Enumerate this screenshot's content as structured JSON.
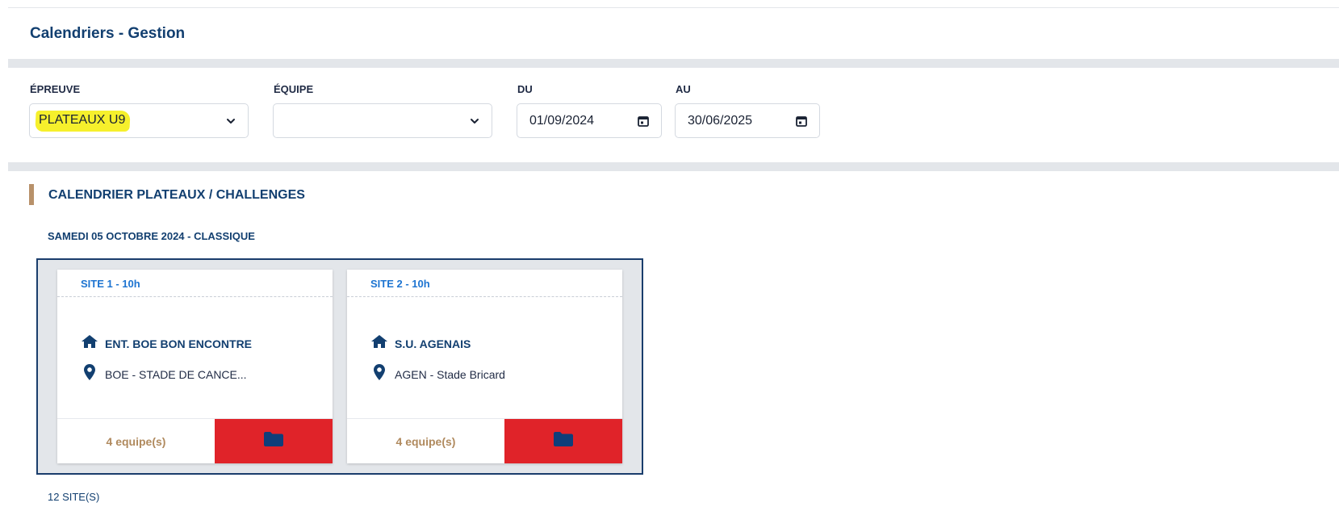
{
  "page": {
    "title": "Calendriers - Gestion"
  },
  "filters": {
    "epreuve": {
      "label": "ÉPREUVE",
      "value": "PLATEAUX U9"
    },
    "equipe": {
      "label": "ÉQUIPE",
      "value": ""
    },
    "du": {
      "label": "DU",
      "value": "01/09/2024"
    },
    "au": {
      "label": "AU",
      "value": "30/06/2025"
    }
  },
  "section": {
    "title": "CALENDRIER PLATEAUX / CHALLENGES",
    "event_date": "SAMEDI 05 OCTOBRE 2024 - CLASSIQUE",
    "sites": [
      {
        "header": "SITE 1 - 10h",
        "club": "ENT. BOE BON ENCONTRE",
        "location": "BOE - STADE DE CANCE...",
        "teams": "4 equipe(s)"
      },
      {
        "header": "SITE 2 - 10h",
        "club": "S.U. AGENAIS",
        "location": "AGEN - Stade Bricard",
        "teams": "4 equipe(s)"
      }
    ],
    "site_count": "12 SITE(S)"
  },
  "icons": {
    "home": "home-icon",
    "location": "map-pin-icon",
    "folder": "folder-icon",
    "dropdown": "chevron-down-icon",
    "calendar": "calendar-icon"
  },
  "colors": {
    "primary": "#123f70",
    "accent_blue": "#1d74d1",
    "accent_gold": "#b8916a",
    "action_red": "#e02329",
    "highlight": "#f6f02c"
  }
}
